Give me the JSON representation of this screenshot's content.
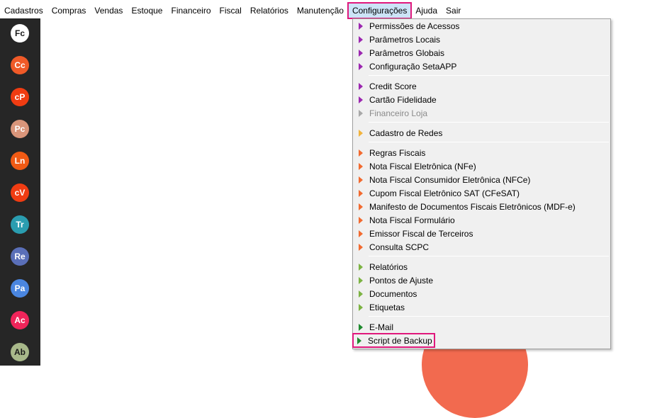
{
  "menubar": {
    "items": [
      "Cadastros",
      "Compras",
      "Vendas",
      "Estoque",
      "Financeiro",
      "Fiscal",
      "Relatórios",
      "Manutenção",
      "Configurações",
      "Ajuda",
      "Sair"
    ],
    "active": "Configurações"
  },
  "sidebar": {
    "shortcuts": [
      {
        "label": "Fc",
        "color": "#ffffff"
      },
      {
        "label": "Cc",
        "color": "#f05a28"
      },
      {
        "label": "cP",
        "color": "#f03c12"
      },
      {
        "label": "Pc",
        "color": "#d9957a"
      },
      {
        "label": "Ln",
        "color": "#f05a14"
      },
      {
        "label": "cV",
        "color": "#f03c12"
      },
      {
        "label": "Tr",
        "color": "#2a9db0"
      },
      {
        "label": "Re",
        "color": "#5a6fb8"
      },
      {
        "label": "Pa",
        "color": "#4a86e0"
      },
      {
        "label": "Ac",
        "color": "#f0245a"
      },
      {
        "label": "Ab",
        "color": "#a8b88a"
      }
    ]
  },
  "dropdown": {
    "groups": [
      {
        "arrow_color": "#9c27b0",
        "items": [
          {
            "label": "Permissões de Acessos",
            "enabled": true
          },
          {
            "label": "Parâmetros Locais",
            "enabled": true
          },
          {
            "label": "Parâmetros Globais",
            "enabled": true
          },
          {
            "label": "Configuração SetaAPP",
            "enabled": true
          }
        ]
      },
      {
        "arrow_color": "#9c27b0",
        "items": [
          {
            "label": "Credit Score",
            "enabled": true
          },
          {
            "label": "Cartão Fidelidade",
            "enabled": true
          },
          {
            "label": "Financeiro Loja",
            "enabled": false
          }
        ]
      },
      {
        "arrow_color": "#f2b33d",
        "items": [
          {
            "label": "Cadastro de Redes",
            "enabled": true
          }
        ]
      },
      {
        "arrow_color": "#f26a2f",
        "items": [
          {
            "label": "Regras Fiscais",
            "enabled": true
          },
          {
            "label": "Nota Fiscal Eletrônica (NFe)",
            "enabled": true
          },
          {
            "label": "Nota Fiscal Consumidor Eletrônica (NFCe)",
            "enabled": true
          },
          {
            "label": "Cupom Fiscal Eletrônico SAT (CFeSAT)",
            "enabled": true
          },
          {
            "label": "Manifesto de Documentos Fiscais Eletrônicos (MDF-e)",
            "enabled": true
          },
          {
            "label": "Nota Fiscal Formulário",
            "enabled": true
          },
          {
            "label": "Emissor Fiscal de Terceiros",
            "enabled": true
          },
          {
            "label": "Consulta SCPC",
            "enabled": true
          }
        ]
      },
      {
        "arrow_color": "#7cb342",
        "items": [
          {
            "label": "Relatórios",
            "enabled": true
          },
          {
            "label": "Pontos de Ajuste",
            "enabled": true
          },
          {
            "label": "Documentos",
            "enabled": true
          },
          {
            "label": "Etiquetas",
            "enabled": true
          }
        ]
      },
      {
        "arrow_color": "#1e8a2e",
        "items": [
          {
            "label": "E-Mail",
            "enabled": true
          },
          {
            "label": "Script de Backup",
            "enabled": true,
            "highlighted": true
          }
        ]
      }
    ]
  },
  "colors": {
    "highlight_border": "#e0187c",
    "sidebar_bg": "#262626",
    "menu_bg": "#f0f0f0",
    "decor_circle": "#f26a4f"
  }
}
